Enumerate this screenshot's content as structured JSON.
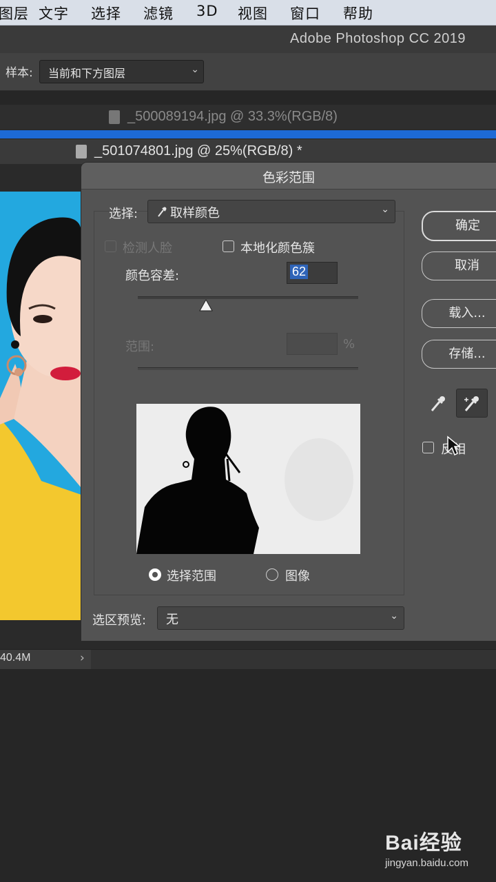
{
  "menu": {
    "items": [
      "图层",
      "文字",
      "选择",
      "滤镜",
      "3D",
      "视图",
      "窗口",
      "帮助"
    ]
  },
  "app_title": "Adobe Photoshop CC 2019",
  "options_bar": {
    "sample_label": "样本:",
    "sample_value": "当前和下方图层"
  },
  "tabs": [
    {
      "label": "_500089194.jpg @ 33.3%(RGB/8)"
    },
    {
      "label": "_501074801.jpg @ 25%(RGB/8) *"
    }
  ],
  "status": {
    "size": "40.4M"
  },
  "dialog": {
    "title": "色彩范围",
    "select_label": "选择:",
    "select_value": "取样颜色",
    "detect_faces": "检测人脸",
    "localized_clusters": "本地化颜色簇",
    "fuzziness_label": "颜色容差:",
    "fuzziness_value": "62",
    "fuzziness_fraction": 0.31,
    "range_label": "范围:",
    "range_unit": "%",
    "radio_selection": "选择范围",
    "radio_image": "图像",
    "preview_label": "选区预览:",
    "preview_value": "无",
    "ok": "确定",
    "cancel": "取消",
    "load": "载入...",
    "save": "存储...",
    "invert": "反相"
  },
  "watermark": {
    "brand": "Bai经验",
    "url": "jingyan.baidu.com"
  },
  "colors": {
    "accent": "#1d6ad6",
    "photo_bg": "#23a8df"
  }
}
